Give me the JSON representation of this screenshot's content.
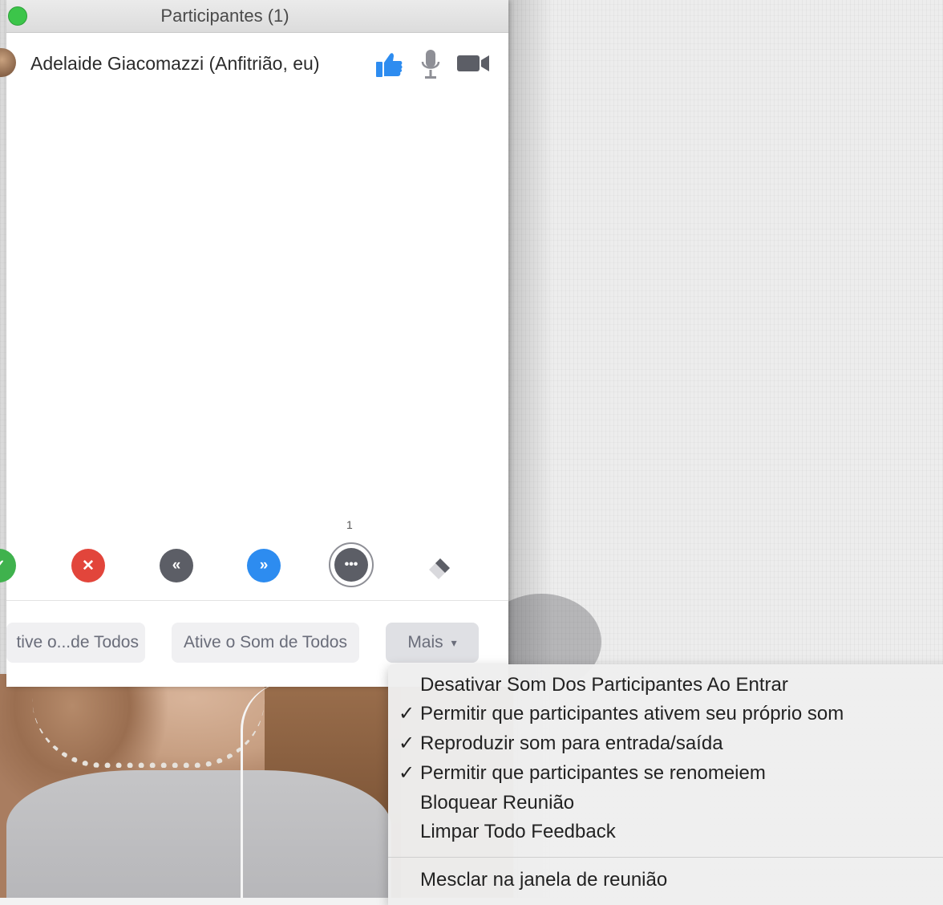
{
  "window": {
    "title": "Participantes (1)"
  },
  "participant": {
    "name": "Adelaide Giacomazzi (Anfitrião, eu)",
    "icons": [
      "thumbs-up-icon",
      "microphone-icon",
      "video-camera-icon"
    ]
  },
  "reactions": {
    "count_badge": "1",
    "icons": [
      "yes-icon",
      "no-icon",
      "go-slower-icon",
      "go-faster-icon",
      "more-icon",
      "clear-all-icon"
    ],
    "colors": {
      "yes": "#3fb24d",
      "no": "#e2453b",
      "slower": "#5c5e66",
      "faster": "#2d8cf0"
    }
  },
  "bottom": {
    "mute_all": "tive o...de Todos",
    "unmute_all": "Ative o Som de Todos",
    "more": "Mais"
  },
  "menu": {
    "items": [
      {
        "label": "Desativar Som Dos Participantes Ao Entrar",
        "check": ""
      },
      {
        "label": "Permitir que participantes ativem seu próprio som",
        "check": "✓"
      },
      {
        "label": "Reproduzir som para entrada/saída",
        "check": "✓"
      },
      {
        "label": "Permitir que participantes se renomeiem",
        "check": "✓"
      },
      {
        "label": "Bloquear Reunião",
        "check": ""
      },
      {
        "label": "Limpar Todo Feedback",
        "check": ""
      }
    ],
    "merge": "Mesclar na janela de reunião"
  }
}
